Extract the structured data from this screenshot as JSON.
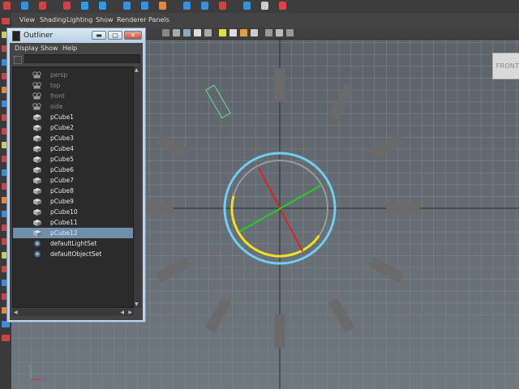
{
  "viewport": {
    "menu": [
      "View",
      "Shading",
      "Lighting",
      "Show",
      "Renderer",
      "Panels"
    ],
    "camera_label": "FRONT"
  },
  "outliner": {
    "title": "Outliner",
    "menus": [
      "Display",
      "Show",
      "Help"
    ],
    "window_buttons": {
      "minimize": "▬",
      "maximize": "▢",
      "close": "✕"
    },
    "items": [
      {
        "name": "persp",
        "type": "camera",
        "dim": true,
        "selected": false
      },
      {
        "name": "top",
        "type": "camera",
        "dim": true,
        "selected": false
      },
      {
        "name": "front",
        "type": "camera",
        "dim": true,
        "selected": false
      },
      {
        "name": "side",
        "type": "camera",
        "dim": true,
        "selected": false
      },
      {
        "name": "pCube1",
        "type": "mesh",
        "dim": false,
        "selected": false
      },
      {
        "name": "pCube2",
        "type": "mesh",
        "dim": false,
        "selected": false
      },
      {
        "name": "pCube3",
        "type": "mesh",
        "dim": false,
        "selected": false
      },
      {
        "name": "pCube4",
        "type": "mesh",
        "dim": false,
        "selected": false
      },
      {
        "name": "pCube5",
        "type": "mesh",
        "dim": false,
        "selected": false
      },
      {
        "name": "pCube6",
        "type": "mesh",
        "dim": false,
        "selected": false
      },
      {
        "name": "pCube7",
        "type": "mesh",
        "dim": false,
        "selected": false
      },
      {
        "name": "pCube8",
        "type": "mesh",
        "dim": false,
        "selected": false
      },
      {
        "name": "pCube9",
        "type": "mesh",
        "dim": false,
        "selected": false
      },
      {
        "name": "pCube10",
        "type": "mesh",
        "dim": false,
        "selected": false
      },
      {
        "name": "pCube11",
        "type": "mesh",
        "dim": false,
        "selected": false
      },
      {
        "name": "pCube12",
        "type": "mesh",
        "dim": false,
        "selected": true
      },
      {
        "name": "defaultLightSet",
        "type": "set",
        "dim": false,
        "selected": false
      },
      {
        "name": "defaultObjectSet",
        "type": "set",
        "dim": false,
        "selected": false
      }
    ]
  },
  "scene": {
    "colors": {
      "grid": "#7c848c",
      "grid_axis": "#2a2a2a",
      "cube": "#6a6a6a",
      "selected_outline": "#5fe08a",
      "rotate_outer": "#6ecff0",
      "rotate_yellow": "#f0e020",
      "rotate_gray": "#9a9a9a",
      "axis_red": "#e02020",
      "axis_green": "#20d020"
    }
  }
}
